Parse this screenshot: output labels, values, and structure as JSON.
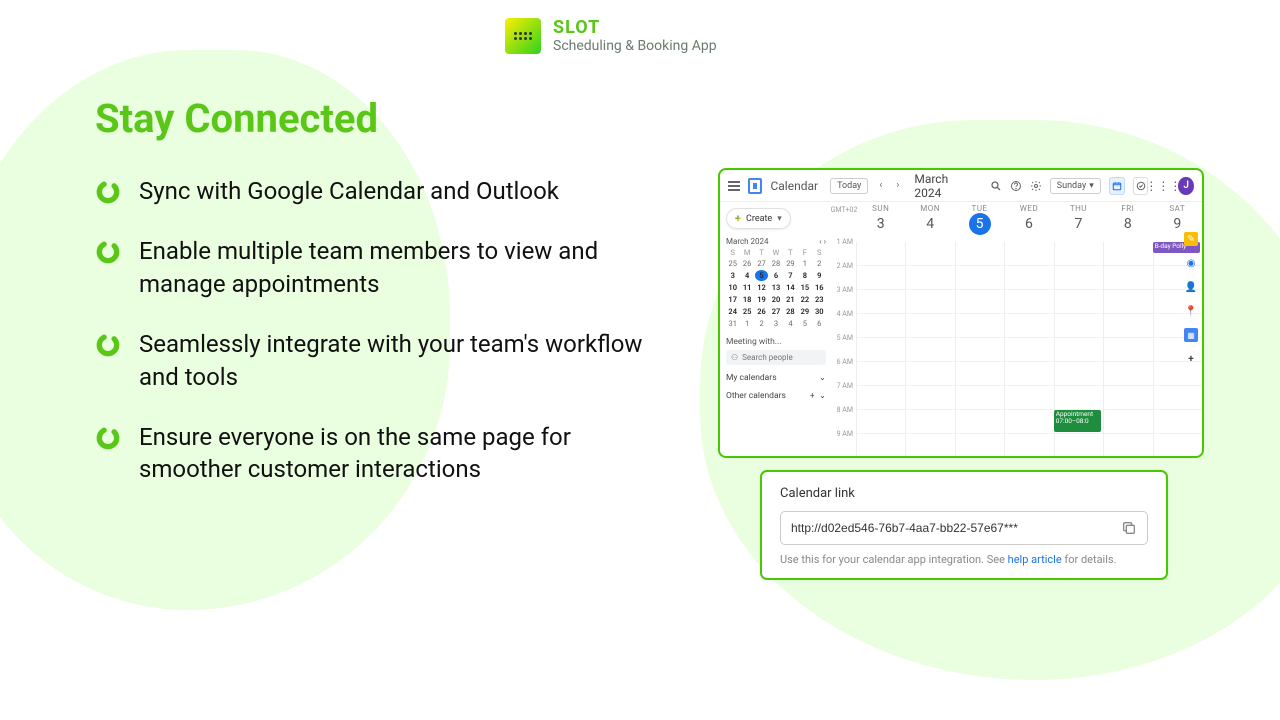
{
  "brand": {
    "name": "SLOT",
    "subtitle": "Scheduling & Booking App"
  },
  "heading": "Stay Connected",
  "bullets": [
    "Sync with Google Calendar and Outlook",
    "Enable multiple team members to view and manage appointments",
    "Seamlessly integrate with your team's workflow and tools",
    "Ensure everyone is on the same page for smoother customer interactions"
  ],
  "calendar": {
    "app_name": "Calendar",
    "today_label": "Today",
    "month_label": "March 2024",
    "view_label": "Sunday",
    "avatar_initial": "J",
    "create_label": "Create",
    "timezone": "GMT+02",
    "mini_month": "March 2024",
    "mini_dows": [
      "S",
      "M",
      "T",
      "W",
      "T",
      "F",
      "S"
    ],
    "mini_days": [
      [
        "25",
        "26",
        "27",
        "28",
        "29",
        "1",
        "2"
      ],
      [
        "3",
        "4",
        "5",
        "6",
        "7",
        "8",
        "9"
      ],
      [
        "10",
        "11",
        "12",
        "13",
        "14",
        "15",
        "16"
      ],
      [
        "17",
        "18",
        "19",
        "20",
        "21",
        "22",
        "23"
      ],
      [
        "24",
        "25",
        "26",
        "27",
        "28",
        "29",
        "30"
      ],
      [
        "31",
        "1",
        "2",
        "3",
        "4",
        "5",
        "6"
      ]
    ],
    "mini_selected": "5",
    "meeting_label": "Meeting with...",
    "search_placeholder": "Search people",
    "my_calendars": "My calendars",
    "other_calendars": "Other calendars",
    "days": [
      {
        "dow": "SUN",
        "date": "3"
      },
      {
        "dow": "MON",
        "date": "4"
      },
      {
        "dow": "TUE",
        "date": "5",
        "today": true
      },
      {
        "dow": "WED",
        "date": "6"
      },
      {
        "dow": "THU",
        "date": "7"
      },
      {
        "dow": "FRI",
        "date": "8"
      },
      {
        "dow": "SAT",
        "date": "9"
      }
    ],
    "hours": [
      "1 AM",
      "2 AM",
      "3 AM",
      "4 AM",
      "5 AM",
      "6 AM",
      "7 AM",
      "8 AM",
      "9 AM"
    ],
    "events": {
      "bday": "B-day Polly",
      "appt_title": "Appointment",
      "appt_time": "07:00–08:0"
    }
  },
  "link_card": {
    "title": "Calendar link",
    "url": "http://d02ed546-76b7-4aa7-bb22-57e67***",
    "help_pre": "Use this for your calendar app integration. See ",
    "help_link": "help article",
    "help_post": " for details."
  }
}
